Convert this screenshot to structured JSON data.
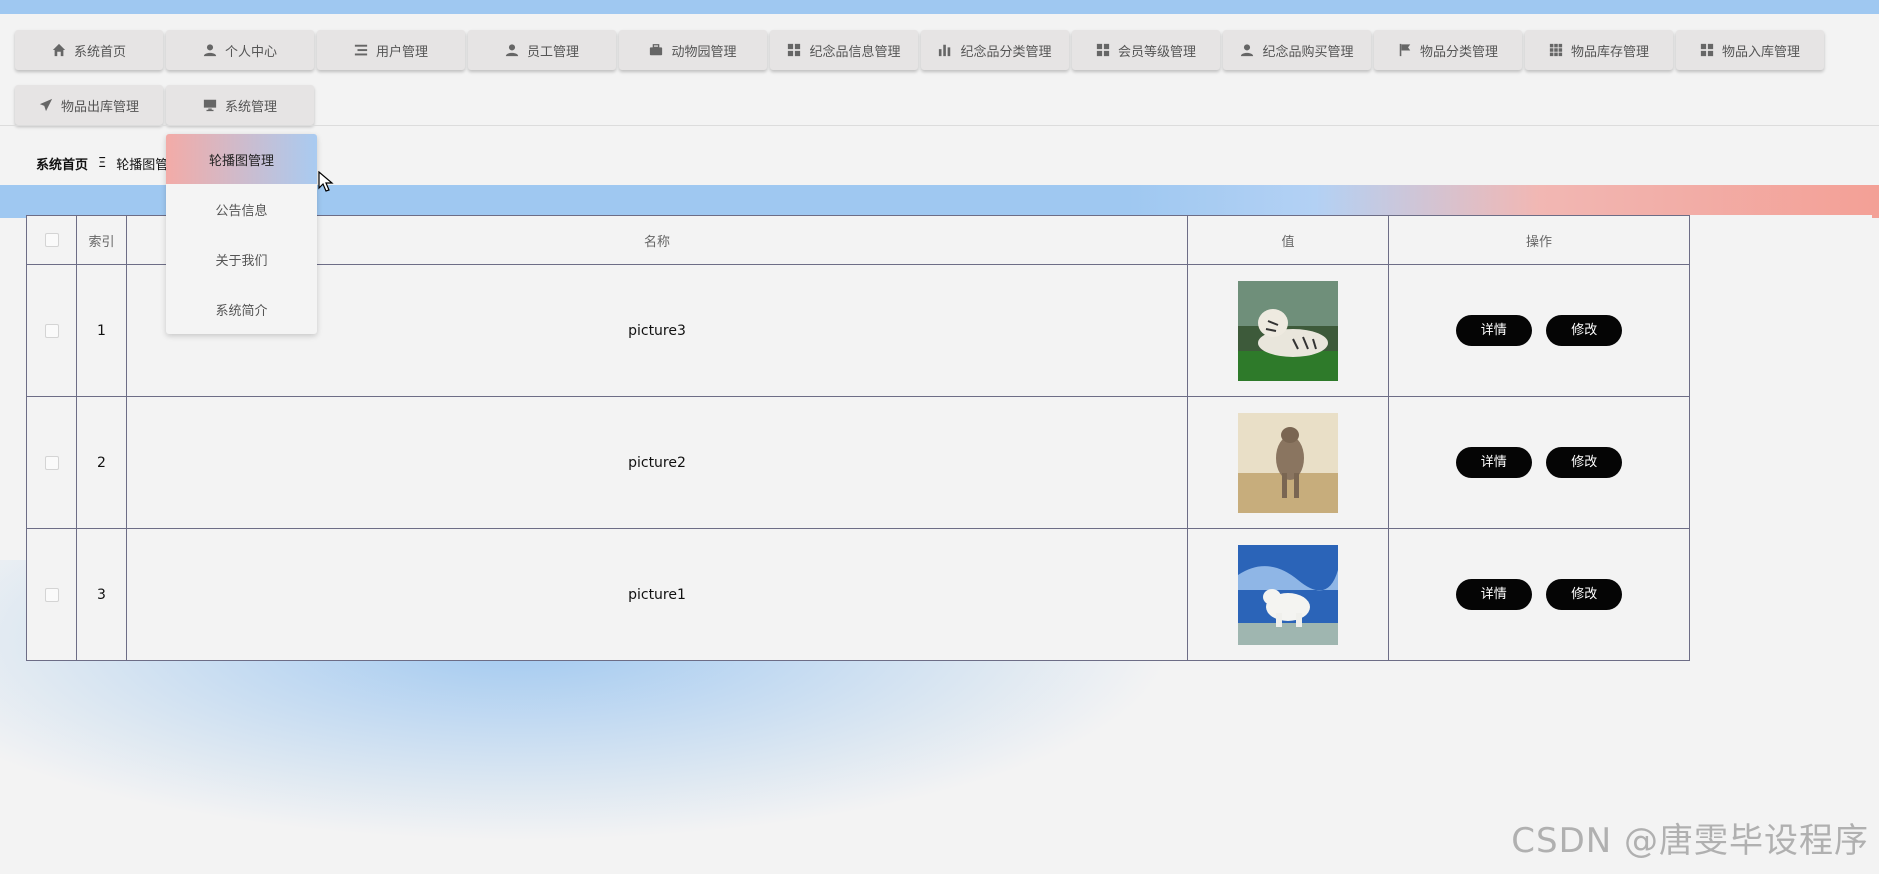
{
  "nav": {
    "items": [
      {
        "label": "系统首页",
        "icon": "home-icon"
      },
      {
        "label": "个人中心",
        "icon": "user-icon"
      },
      {
        "label": "用户管理",
        "icon": "list-icon"
      },
      {
        "label": "员工管理",
        "icon": "user-icon"
      },
      {
        "label": "动物园管理",
        "icon": "briefcase-icon"
      },
      {
        "label": "纪念品信息管理",
        "icon": "grid-icon"
      },
      {
        "label": "纪念品分类管理",
        "icon": "bar-chart-icon"
      },
      {
        "label": "会员等级管理",
        "icon": "grid-icon"
      },
      {
        "label": "纪念品购买管理",
        "icon": "user-icon"
      },
      {
        "label": "物品分类管理",
        "icon": "flag-icon"
      },
      {
        "label": "物品库存管理",
        "icon": "dots-grid-icon"
      },
      {
        "label": "物品入库管理",
        "icon": "grid-icon"
      },
      {
        "label": "物品出库管理",
        "icon": "send-icon"
      },
      {
        "label": "系统管理",
        "icon": "monitor-icon"
      }
    ]
  },
  "dropdown": {
    "items": [
      {
        "label": "轮播图管理",
        "active": true
      },
      {
        "label": "公告信息",
        "active": false
      },
      {
        "label": "关于我们",
        "active": false
      },
      {
        "label": "系统简介",
        "active": false
      }
    ]
  },
  "breadcrumb": {
    "home": "系统首页",
    "separator": "Ξ",
    "current": "轮播图管理"
  },
  "table": {
    "headers": {
      "index": "索引",
      "name": "名称",
      "value": "值",
      "actions": "操作"
    },
    "rows": [
      {
        "index": "1",
        "name": "picture3",
        "image": "white-tiger"
      },
      {
        "index": "2",
        "name": "picture2",
        "image": "leopard"
      },
      {
        "index": "3",
        "name": "picture1",
        "image": "polar-bear"
      }
    ],
    "actions": {
      "detail": "详情",
      "edit": "修改"
    }
  },
  "watermark": "CSDN @唐雯毕设程序",
  "colors": {
    "accent_blue": "#9fc8f1",
    "accent_pink": "#f3a096",
    "button": "#050505"
  }
}
